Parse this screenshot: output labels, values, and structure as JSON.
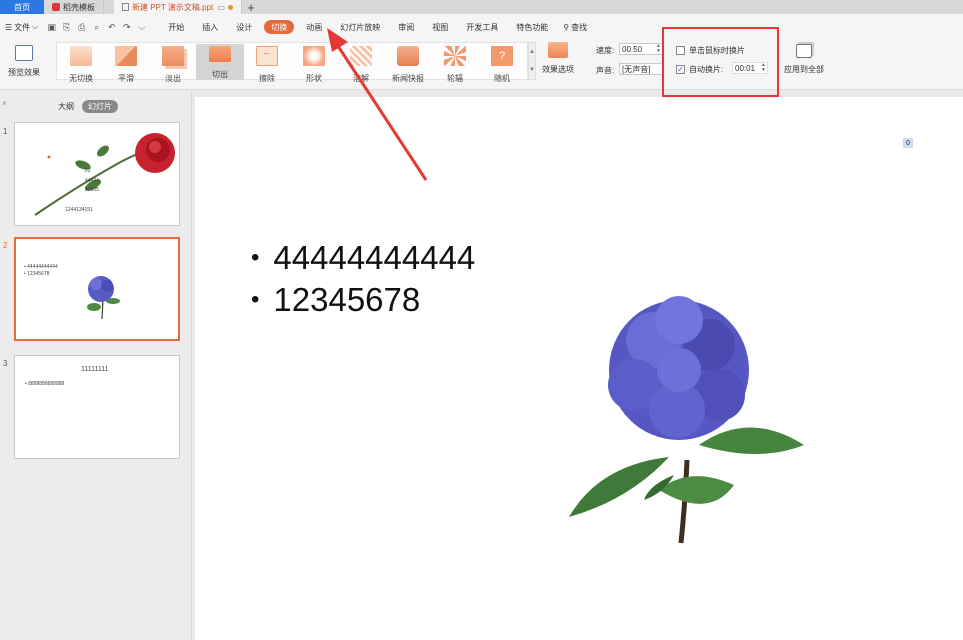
{
  "titlebar": {
    "home_tab": "首页",
    "tabs": [
      {
        "label": "稻壳模板"
      },
      {
        "label": "新建 PPT 演示文稿.ppt"
      }
    ],
    "new_tab": "+"
  },
  "menubar": {
    "file": "文件",
    "items": [
      "开始",
      "插入",
      "设计",
      "切换",
      "动画",
      "幻灯片放映",
      "审阅",
      "视图",
      "开发工具",
      "特色功能"
    ],
    "active": "切换",
    "search": "查找"
  },
  "ribbon": {
    "preview": "预览效果",
    "transitions": [
      "无切换",
      "平滑",
      "淡出",
      "切出",
      "擦除",
      "形状",
      "溶解",
      "新闻快报",
      "轮辐",
      "随机"
    ],
    "selected_transition": "切出",
    "effect_options": "效果选项",
    "speed_label": "速度:",
    "speed_value": "00.50",
    "sound_label": "声音:",
    "sound_value": "[无声音]",
    "on_click_label": "单击鼠标时换片",
    "on_click_checked": false,
    "auto_label": "自动换片:",
    "auto_checked": true,
    "auto_value": "00:01",
    "apply_all": "应用到全部"
  },
  "left_panel": {
    "tabs": [
      "大纲",
      "幻灯片"
    ],
    "active_tab": "幻灯片",
    "slides": [
      {
        "number": "1",
        "lines": [
          "22",
          "44444",
          "55555",
          "1244134151"
        ]
      },
      {
        "number": "2",
        "lines": [
          "44444444444",
          "12345678"
        ]
      },
      {
        "number": "3",
        "title": "11111111",
        "lines": [
          "8888888888888"
        ]
      }
    ],
    "selected_slide": "2"
  },
  "slide": {
    "badge": "0",
    "bullets": [
      "44444444444",
      "12345678"
    ]
  },
  "colors": {
    "accent": "#e56a3a",
    "highlight_frame": "#e53935",
    "home_tab": "#2b78e4"
  }
}
